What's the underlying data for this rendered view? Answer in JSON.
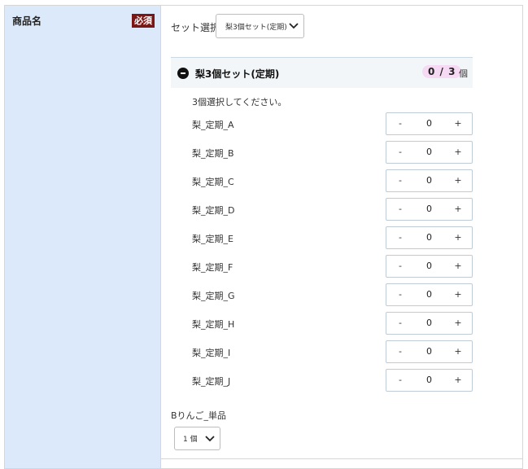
{
  "field": {
    "label": "商品名",
    "required_badge": "必須"
  },
  "set_select": {
    "label": "セット選択",
    "value": "梨3個セット(定期)"
  },
  "set_panel": {
    "title": "梨3個セット(定期)",
    "selected_count": "0",
    "separator": "/",
    "required_count": "3",
    "unit": "個",
    "instruction": "3個選択してください。"
  },
  "items": [
    {
      "name": "梨_定期_A",
      "minus": "-",
      "value": "0",
      "plus": "+"
    },
    {
      "name": "梨_定期_B",
      "minus": "-",
      "value": "0",
      "plus": "+"
    },
    {
      "name": "梨_定期_C",
      "minus": "-",
      "value": "0",
      "plus": "+"
    },
    {
      "name": "梨_定期_D",
      "minus": "-",
      "value": "0",
      "plus": "+"
    },
    {
      "name": "梨_定期_E",
      "minus": "-",
      "value": "0",
      "plus": "+"
    },
    {
      "name": "梨_定期_F",
      "minus": "-",
      "value": "0",
      "plus": "+"
    },
    {
      "name": "梨_定期_G",
      "minus": "-",
      "value": "0",
      "plus": "+"
    },
    {
      "name": "梨_定期_H",
      "minus": "-",
      "value": "0",
      "plus": "+"
    },
    {
      "name": "梨_定期_I",
      "minus": "-",
      "value": "0",
      "plus": "+"
    },
    {
      "name": "梨_定期_J",
      "minus": "-",
      "value": "0",
      "plus": "+"
    }
  ],
  "single_item": {
    "label": "Bりんご_単品",
    "quantity_value": "1 個"
  },
  "icons": {
    "collapse": "minus-circle-icon",
    "dropdown": "chevron-down-icon"
  },
  "colors": {
    "label_bg": "#dce9fb",
    "required_bg": "#7a1616",
    "counter_bg": "#f6d9f2",
    "panel_bg": "#f3f6f8"
  }
}
